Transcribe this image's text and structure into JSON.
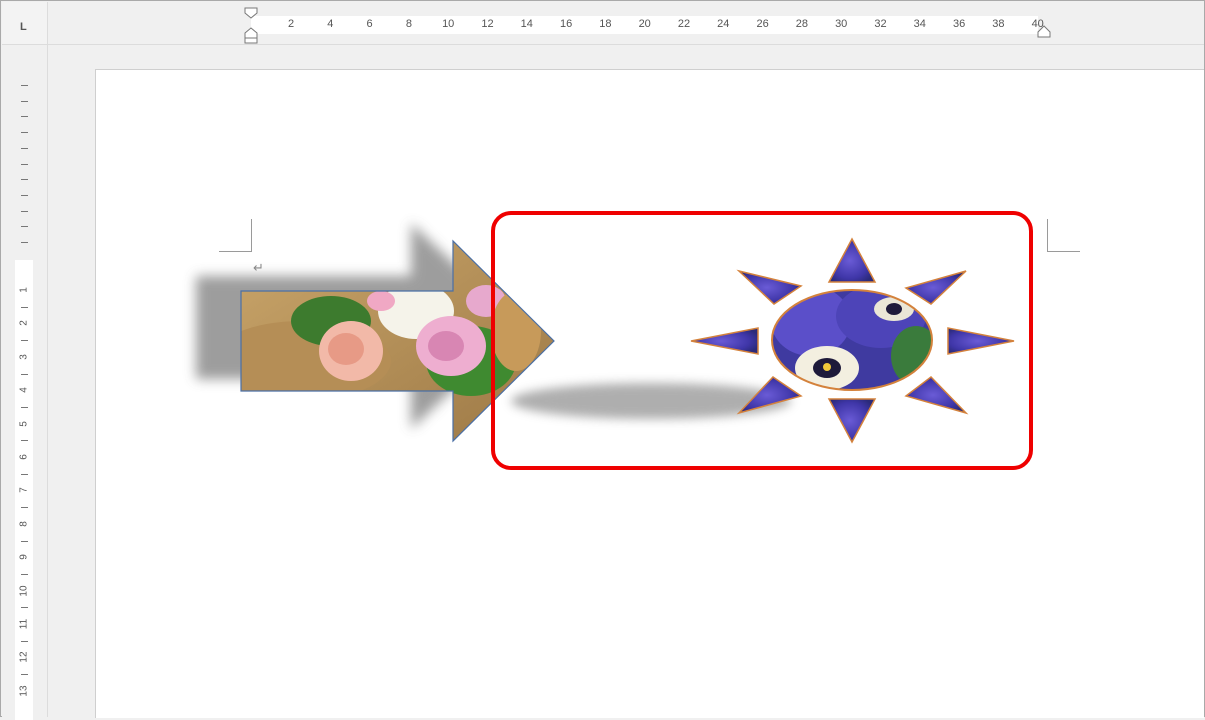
{
  "ruler": {
    "tab_stop": "L",
    "horizontal": [
      "2",
      "4",
      "6",
      "8",
      "10",
      "12",
      "14",
      "16",
      "18",
      "20",
      "22",
      "24",
      "26",
      "28",
      "30",
      "32",
      "34",
      "36",
      "38",
      "40"
    ],
    "vertical": [
      "1",
      "2",
      "3",
      "4",
      "5",
      "6",
      "7",
      "8",
      "9",
      "10",
      "11",
      "12",
      "13"
    ]
  },
  "document": {
    "paragraph_mark": "↵"
  },
  "colors": {
    "highlight": "#ef0000",
    "shape_outline_blue": "#4a6fa5",
    "shape_outline_orange": "#d4823c",
    "shadow": "#8c8c8c"
  },
  "icons": {
    "left_indent_marker": "hourglass-marker",
    "right_indent_marker": "right-indent-marker"
  }
}
